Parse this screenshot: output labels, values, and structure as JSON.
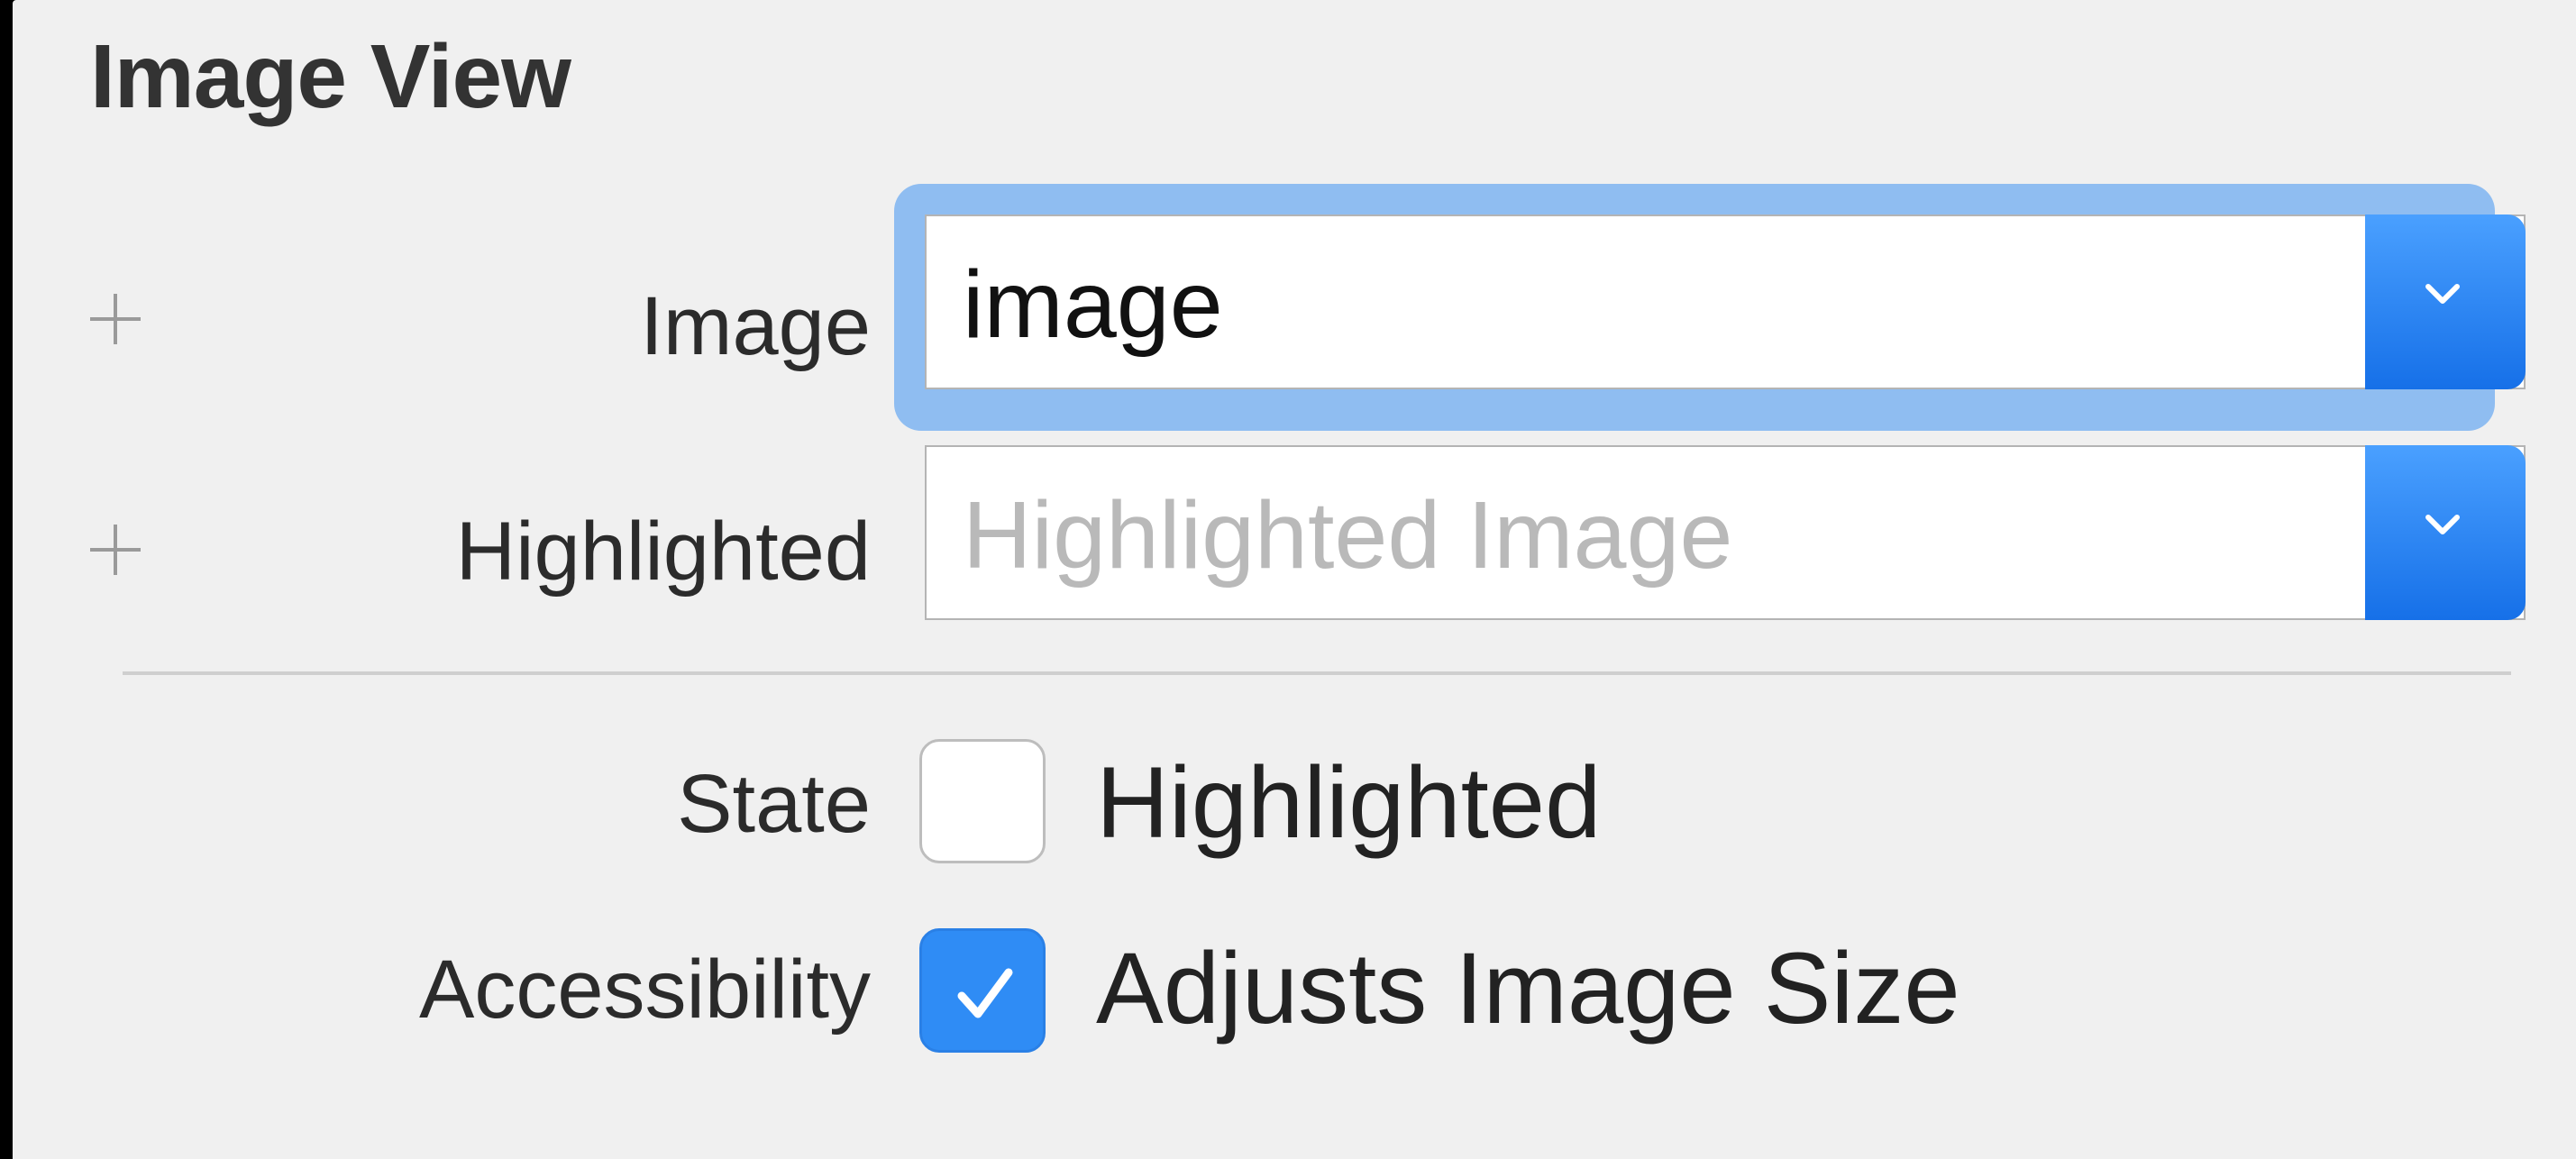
{
  "section": {
    "title": "Image View"
  },
  "image_row": {
    "label": "Image",
    "value": "image"
  },
  "highlighted_row": {
    "label": "Highlighted",
    "placeholder": "Highlighted Image"
  },
  "state_row": {
    "label": "State",
    "checkbox_label": "Highlighted",
    "checked": false
  },
  "accessibility_row": {
    "label": "Accessibility",
    "checkbox_label": "Adjusts Image Size",
    "checked": true
  },
  "icons": {
    "add": "plus-icon",
    "dropdown": "chevron-down-icon",
    "check": "checkmark-icon"
  },
  "colors": {
    "panel_background": "#f0f0f0",
    "accent_blue": "#2f8cf5",
    "focus_ring": "#8fbdf1"
  }
}
